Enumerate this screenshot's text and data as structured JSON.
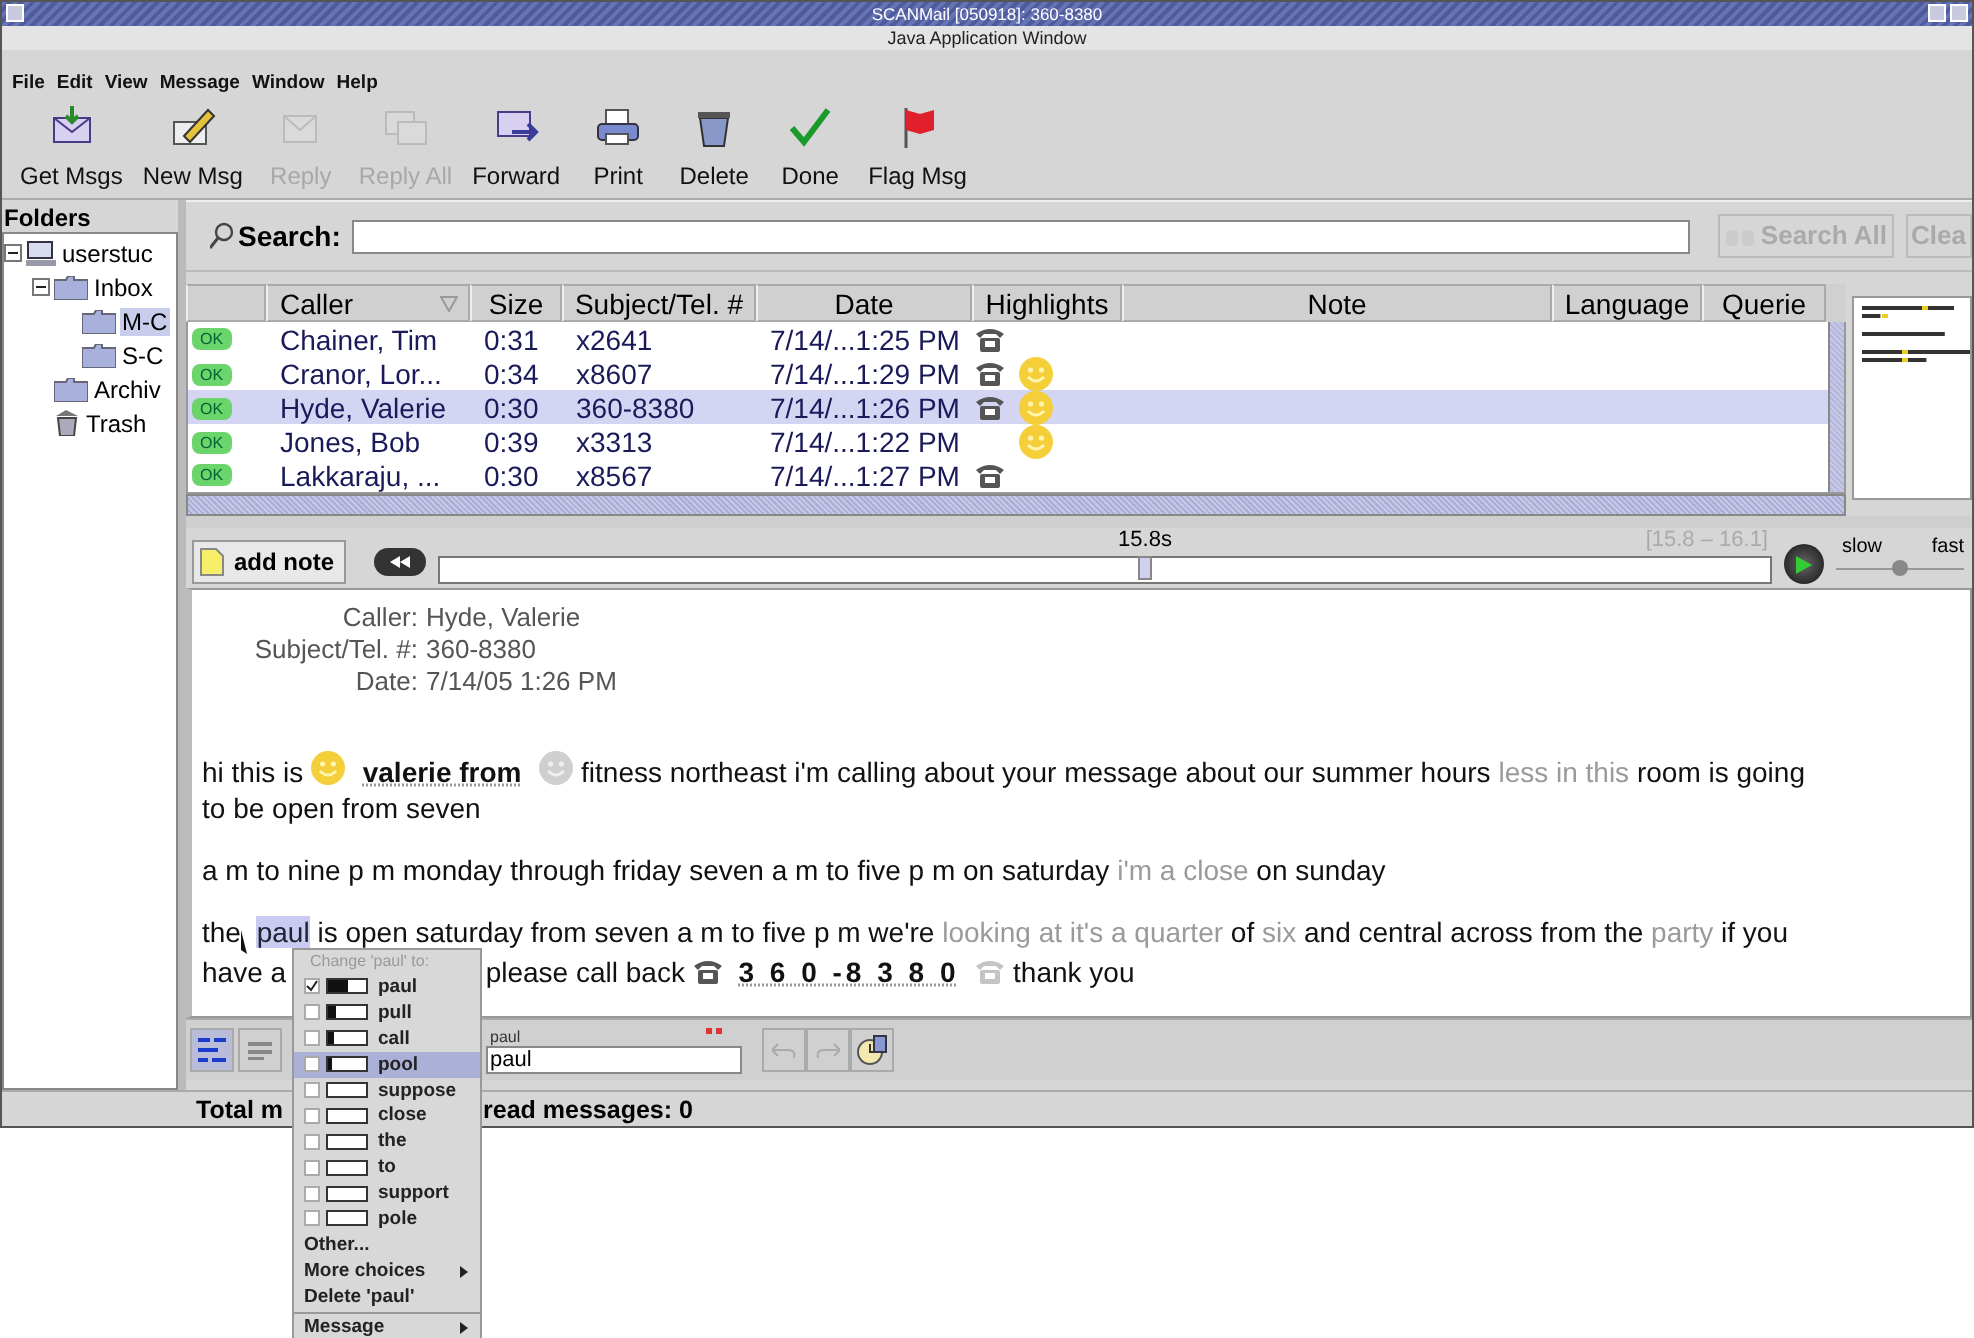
{
  "window": {
    "title": "SCANMail [050918]: 360-8380",
    "subtitle": "Java Application Window"
  },
  "menu_bar": [
    "File",
    "Edit",
    "View",
    "Message",
    "Window",
    "Help"
  ],
  "toolbar": [
    {
      "label": "Get Msgs",
      "kind": "get",
      "disabled": false
    },
    {
      "label": "New Msg",
      "kind": "new",
      "disabled": false
    },
    {
      "label": "Reply",
      "kind": "reply",
      "disabled": true
    },
    {
      "label": "Reply All",
      "kind": "replyall",
      "disabled": true
    },
    {
      "label": "Forward",
      "kind": "forward",
      "disabled": false
    },
    {
      "label": "Print",
      "kind": "print",
      "disabled": false
    },
    {
      "label": "Delete",
      "kind": "delete",
      "disabled": false
    },
    {
      "label": "Done",
      "kind": "done",
      "disabled": false
    },
    {
      "label": "Flag Msg",
      "kind": "flag",
      "disabled": false
    }
  ],
  "folders": {
    "heading": "Folders",
    "tree": [
      {
        "label": "userstuc",
        "kind": "computer",
        "expanded": true,
        "selected": false,
        "children": [
          {
            "label": "Inbox",
            "kind": "folder",
            "expanded": true,
            "selected": false,
            "children": [
              {
                "label": "M-C",
                "kind": "folder",
                "selected": true
              },
              {
                "label": "S-C",
                "kind": "folder",
                "selected": false
              }
            ]
          },
          {
            "label": "Archiv",
            "kind": "folder",
            "selected": false
          },
          {
            "label": "Trash",
            "kind": "trash",
            "selected": false
          }
        ]
      }
    ]
  },
  "search": {
    "label": "Search:",
    "buttons": [
      {
        "label": "Search All",
        "disabled": true
      },
      {
        "label": "Clea",
        "disabled": true
      }
    ]
  },
  "table": {
    "columns": [
      {
        "label": "Caller",
        "sorted": true
      },
      {
        "label": "Size",
        "sorted": false
      },
      {
        "label": "Subject/Tel. #",
        "sorted": false
      },
      {
        "label": "Date",
        "sorted": false
      },
      {
        "label": "Highlights",
        "sorted": false
      },
      {
        "label": "Note",
        "sorted": false
      },
      {
        "label": "Language",
        "sorted": false
      },
      {
        "label": "Querie",
        "sorted": false
      }
    ],
    "rows": [
      {
        "status": "OK",
        "caller": "Chainer, Tim",
        "size": "0:31",
        "subject": "x2641",
        "date": "7/14/...1:25 PM",
        "phone": true,
        "smiley": false,
        "selected": false
      },
      {
        "status": "OK",
        "caller": "Cranor, Lor...",
        "size": "0:34",
        "subject": "x8607",
        "date": "7/14/...1:29 PM",
        "phone": true,
        "smiley": true,
        "selected": false
      },
      {
        "status": "OK",
        "caller": "Hyde, Valerie",
        "size": "0:30",
        "subject": "360-8380",
        "date": "7/14/...1:26 PM",
        "phone": true,
        "smiley": true,
        "selected": true
      },
      {
        "status": "OK",
        "caller": "Jones, Bob",
        "size": "0:39",
        "subject": "x3313",
        "date": "7/14/...1:22 PM",
        "phone": false,
        "smiley": true,
        "selected": false
      },
      {
        "status": "OK",
        "caller": "Lakkaraju, ...",
        "size": "0:30",
        "subject": "x8567",
        "date": "7/14/...1:27 PM",
        "phone": true,
        "smiley": false,
        "selected": false
      }
    ]
  },
  "player": {
    "note_button": "add note",
    "time": "15.8s",
    "range": "[15.8 – 16.1]",
    "level": 0.53,
    "speed": {
      "slow": "slow",
      "fast": "fast",
      "level": 0.5
    }
  },
  "message": {
    "fields": [
      {
        "label": "Caller:",
        "value": "Hyde, Valerie"
      },
      {
        "label": "Subject/Tel. #:",
        "value": "360-8380"
      },
      {
        "label": "Date:",
        "value": "7/14/05 1:26 PM"
      }
    ],
    "paragraphs": [
      [
        {
          "kind": "text",
          "text": "hi this is"
        },
        {
          "kind": "smiley",
          "active": true
        },
        {
          "kind": "keyword",
          "text": "valerie from"
        },
        {
          "kind": "smiley",
          "active": false
        },
        {
          "kind": "text",
          "text": "fitness northeast i'm calling about your message about our summer hours"
        },
        {
          "kind": "dim",
          "text": "less in this"
        },
        {
          "kind": "text",
          "text": "room is going"
        },
        {
          "kind": "break"
        },
        {
          "kind": "text",
          "text": "to be open from seven"
        }
      ],
      [
        {
          "kind": "text",
          "text": "a m to nine p m monday through friday seven a m to five p m on saturday"
        },
        {
          "kind": "dim",
          "text": "i'm a close"
        },
        {
          "kind": "text",
          "text": "on sunday"
        }
      ],
      [
        {
          "kind": "text",
          "text": "the"
        },
        {
          "kind": "cursor"
        },
        {
          "kind": "selected",
          "text": "paul"
        },
        {
          "kind": "text",
          "text": "is open saturday from seven a m to five p m we're"
        },
        {
          "kind": "dim",
          "text": "looking at it's a quarter"
        },
        {
          "kind": "text",
          "text": "of"
        },
        {
          "kind": "dim",
          "text": "six"
        },
        {
          "kind": "text",
          "text": "and central across from the"
        },
        {
          "kind": "dim",
          "text": "party"
        },
        {
          "kind": "text",
          "text": "if you"
        },
        {
          "kind": "break"
        },
        {
          "kind": "text",
          "text": "have a"
        },
        {
          "kind": "covered"
        },
        {
          "kind": "text",
          "text": "please call back"
        },
        {
          "kind": "phone",
          "active": true
        },
        {
          "kind": "number",
          "text": "3 6 0 -8 3 8 0"
        },
        {
          "kind": "phone",
          "active": false
        },
        {
          "kind": "text",
          "text": "thank you"
        }
      ]
    ]
  },
  "edit_bar": {
    "word_label": "paul",
    "value": "paul"
  },
  "status_bar": {
    "left": "Total m",
    "right": "read messages: 0"
  },
  "popup": {
    "title": "Change 'paul' to:",
    "choices": [
      {
        "label": "paul",
        "checked": true,
        "level": 0.5,
        "selected": false
      },
      {
        "label": "pull",
        "checked": false,
        "level": 0.2,
        "selected": false
      },
      {
        "label": "call",
        "checked": false,
        "level": 0.15,
        "selected": false
      },
      {
        "label": "pool",
        "checked": false,
        "level": 0.1,
        "selected": true
      },
      {
        "label": "suppose",
        "checked": false,
        "level": 0,
        "selected": false
      },
      {
        "label": "close",
        "checked": false,
        "level": 0,
        "selected": false
      },
      {
        "label": "the",
        "checked": false,
        "level": 0,
        "selected": false
      },
      {
        "label": "to",
        "checked": false,
        "level": 0,
        "selected": false
      },
      {
        "label": "support",
        "checked": false,
        "level": 0,
        "selected": false
      },
      {
        "label": "pole",
        "checked": false,
        "level": 0,
        "selected": false
      }
    ],
    "actions": [
      {
        "label": "Other...",
        "submenu": false
      },
      {
        "label": "More choices",
        "submenu": true
      },
      {
        "label": "Delete 'paul'",
        "submenu": false
      }
    ],
    "footer": [
      {
        "label": "Message",
        "submenu": true
      }
    ]
  }
}
